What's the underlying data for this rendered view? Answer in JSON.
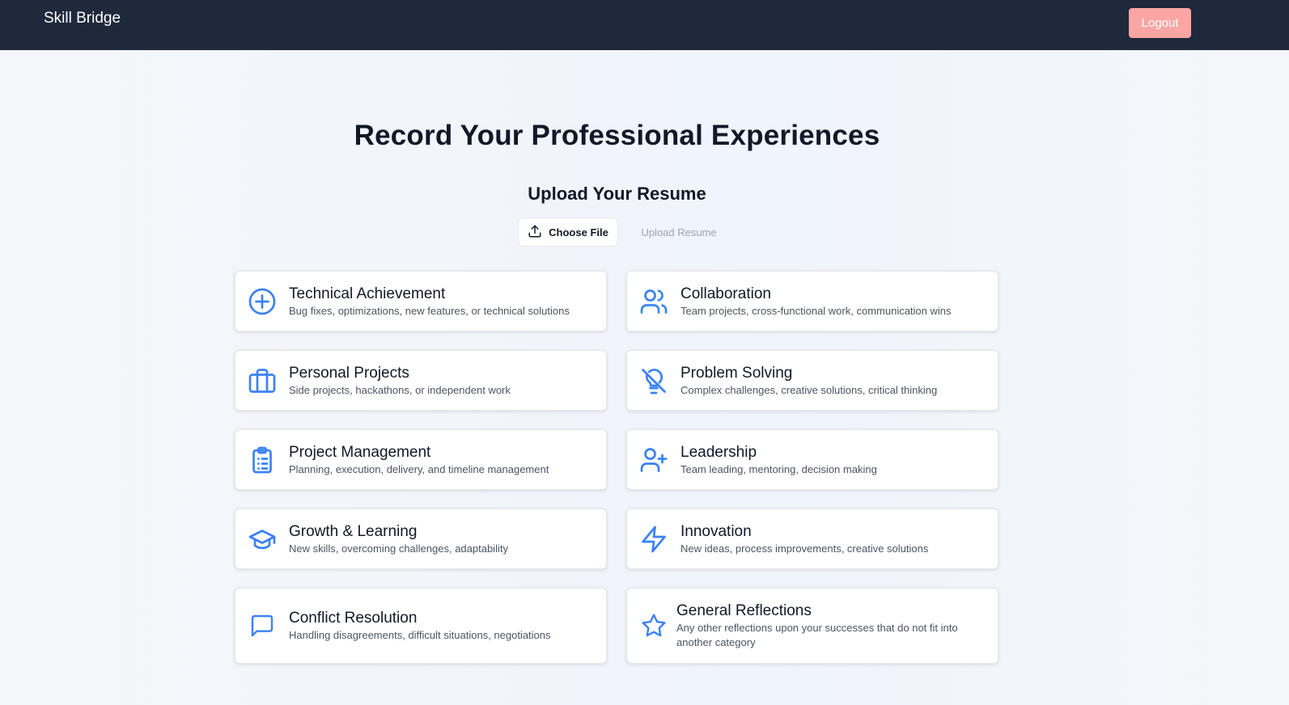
{
  "header": {
    "brand": "Skill Bridge",
    "logout_label": "Logout"
  },
  "main": {
    "title": "Record Your Professional Experiences",
    "upload": {
      "heading": "Upload Your Resume",
      "choose_file_label": "Choose File",
      "upload_label": "Upload Resume"
    },
    "categories": [
      {
        "title": "Technical Achievement",
        "description": "Bug fixes, optimizations, new features, or technical solutions",
        "icon": "plus-circle-icon"
      },
      {
        "title": "Collaboration",
        "description": "Team projects, cross-functional work, communication wins",
        "icon": "users-icon"
      },
      {
        "title": "Personal Projects",
        "description": "Side projects, hackathons, or independent work",
        "icon": "briefcase-icon"
      },
      {
        "title": "Problem Solving",
        "description": "Complex challenges, creative solutions, critical thinking",
        "icon": "lightbulb-off-icon"
      },
      {
        "title": "Project Management",
        "description": "Planning, execution, delivery, and timeline management",
        "icon": "clipboard-list-icon"
      },
      {
        "title": "Leadership",
        "description": "Team leading, mentoring, decision making",
        "icon": "user-plus-icon"
      },
      {
        "title": "Growth & Learning",
        "description": "New skills, overcoming challenges, adaptability",
        "icon": "graduation-cap-icon"
      },
      {
        "title": "Innovation",
        "description": "New ideas, process improvements, creative solutions",
        "icon": "lightning-icon"
      },
      {
        "title": "Conflict Resolution",
        "description": "Handling disagreements, difficult situations, negotiations",
        "icon": "message-square-icon"
      },
      {
        "title": "General Reflections",
        "description": "Any other reflections upon your successes that do not fit into another category",
        "icon": "star-icon"
      }
    ]
  },
  "colors": {
    "header_bg": "#1e293b",
    "logout_bg": "#fca5a5",
    "icon_accent": "#3b82f6"
  }
}
